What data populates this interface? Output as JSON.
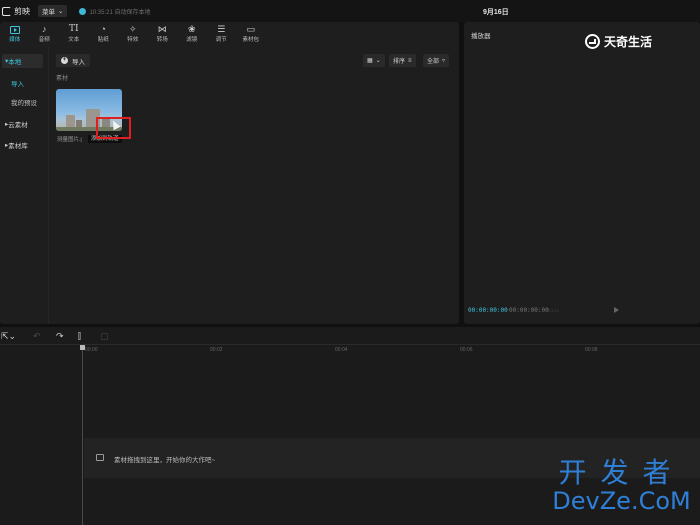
{
  "app": {
    "title": "剪映",
    "menu_label": "菜单",
    "autosave": "10:35:21 自动保存本地",
    "date": "9月16日"
  },
  "toolbar": {
    "tools": [
      {
        "label": "媒体",
        "icon": "media-icon"
      },
      {
        "label": "音频",
        "icon": "audio-icon"
      },
      {
        "label": "文本",
        "icon": "text-icon"
      },
      {
        "label": "贴纸",
        "icon": "sticker-icon"
      },
      {
        "label": "特效",
        "icon": "effects-icon"
      },
      {
        "label": "转场",
        "icon": "transition-icon"
      },
      {
        "label": "滤镜",
        "icon": "filter-icon"
      },
      {
        "label": "调节",
        "icon": "adjust-icon"
      },
      {
        "label": "素材包",
        "icon": "package-icon"
      }
    ],
    "active_index": 0
  },
  "sidebar": {
    "local": "本地",
    "import": "导入",
    "my_presets": "我的预设",
    "cloud": "云素材",
    "library": "素材库"
  },
  "media": {
    "import_label": "导入",
    "sort_label": "排序",
    "filter_label": "全部",
    "section_label": "素材",
    "thumb_caption": "测量图片.j",
    "tooltip": "添加到轨道"
  },
  "player": {
    "title": "播放器",
    "current_time": "00:00:00:00",
    "total_time": "00:00:00:00"
  },
  "timeline": {
    "ticks": [
      "00:00",
      "00:02",
      "00:04",
      "00:06",
      "00:08"
    ],
    "drop_hint": "素材拖拽到这里，开始你的大作吧~"
  },
  "watermarks": {
    "top": "天奇生活",
    "bottom_cn": "开发者",
    "bottom_en": "DevZe.CoM"
  },
  "colors": {
    "accent": "#3fc6e0",
    "highlight": "#e02020",
    "watermark_blue": "#2f7fd6"
  }
}
